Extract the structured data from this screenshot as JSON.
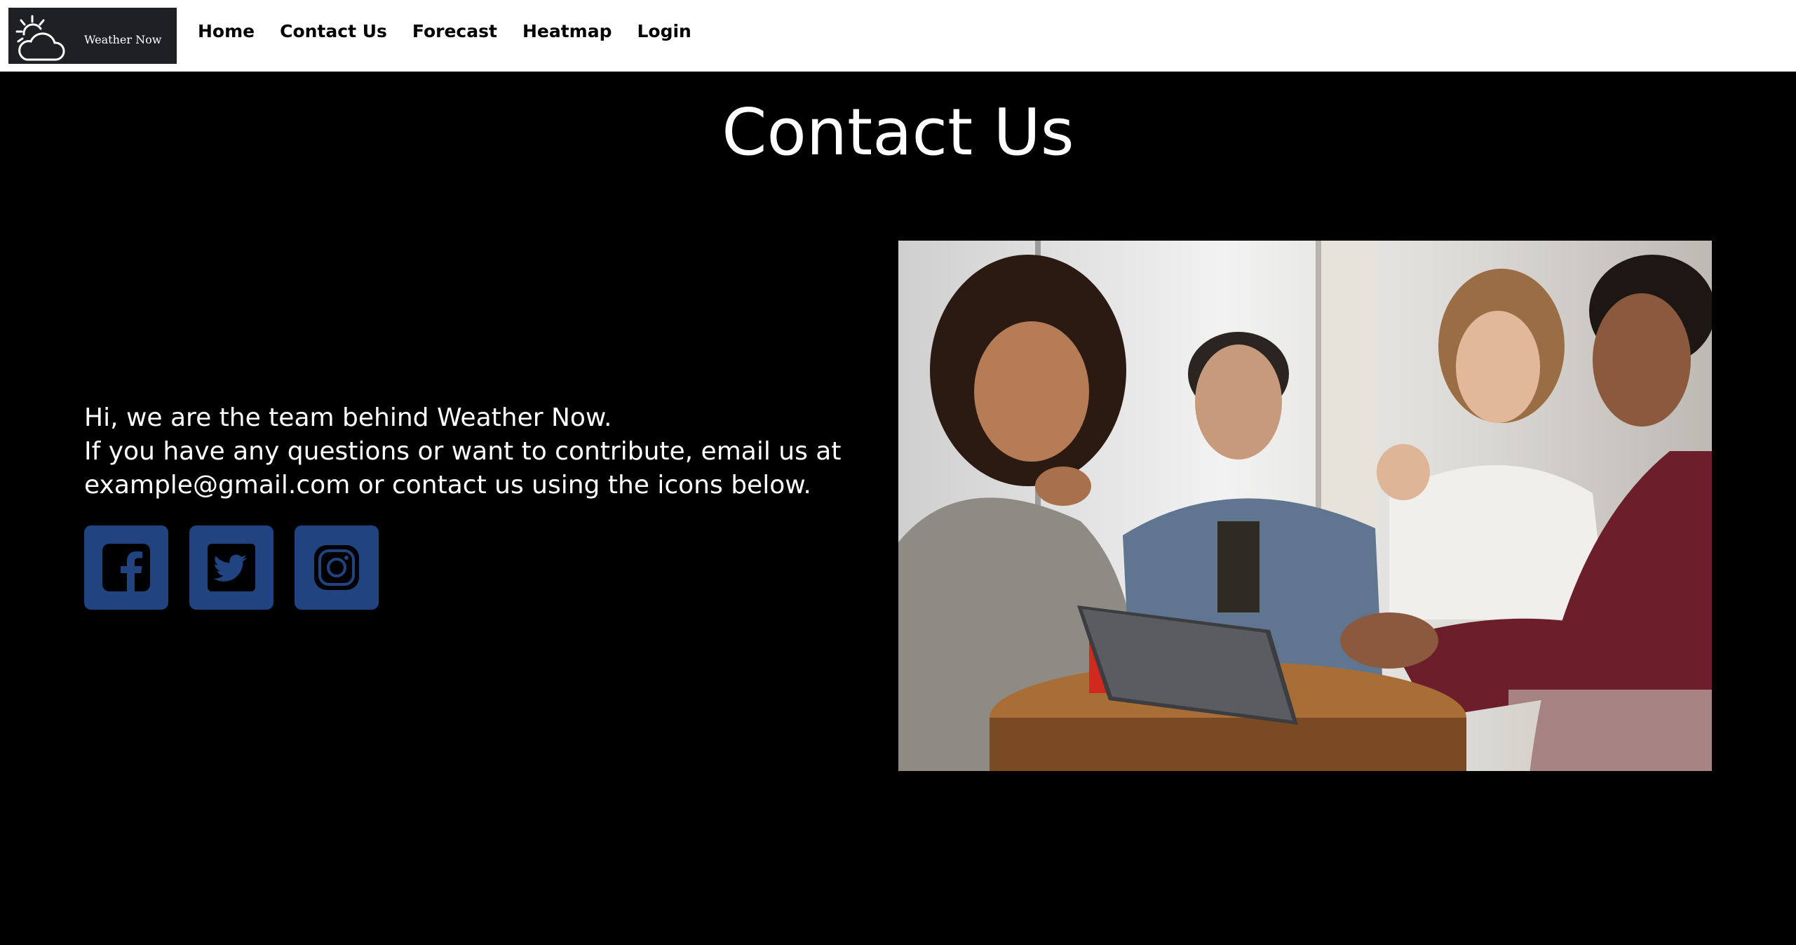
{
  "nav": {
    "logo_text": "Weather Now",
    "links": [
      "Home",
      "Contact Us",
      "Forecast",
      "Heatmap",
      "Login"
    ]
  },
  "page": {
    "title": "Contact Us"
  },
  "intro": {
    "line1": "Hi, we are the team behind Weather Now.",
    "line2": "If you have any questions or want to contribute, email us at example@gmail.com or contact us using the icons below."
  },
  "socials": {
    "items": [
      "facebook-icon",
      "twitter-icon",
      "instagram-icon"
    ]
  },
  "colors": {
    "background": "#000000",
    "navbar": "#ffffff",
    "social_button": "#21437f",
    "logo_bg": "#1f2024"
  }
}
